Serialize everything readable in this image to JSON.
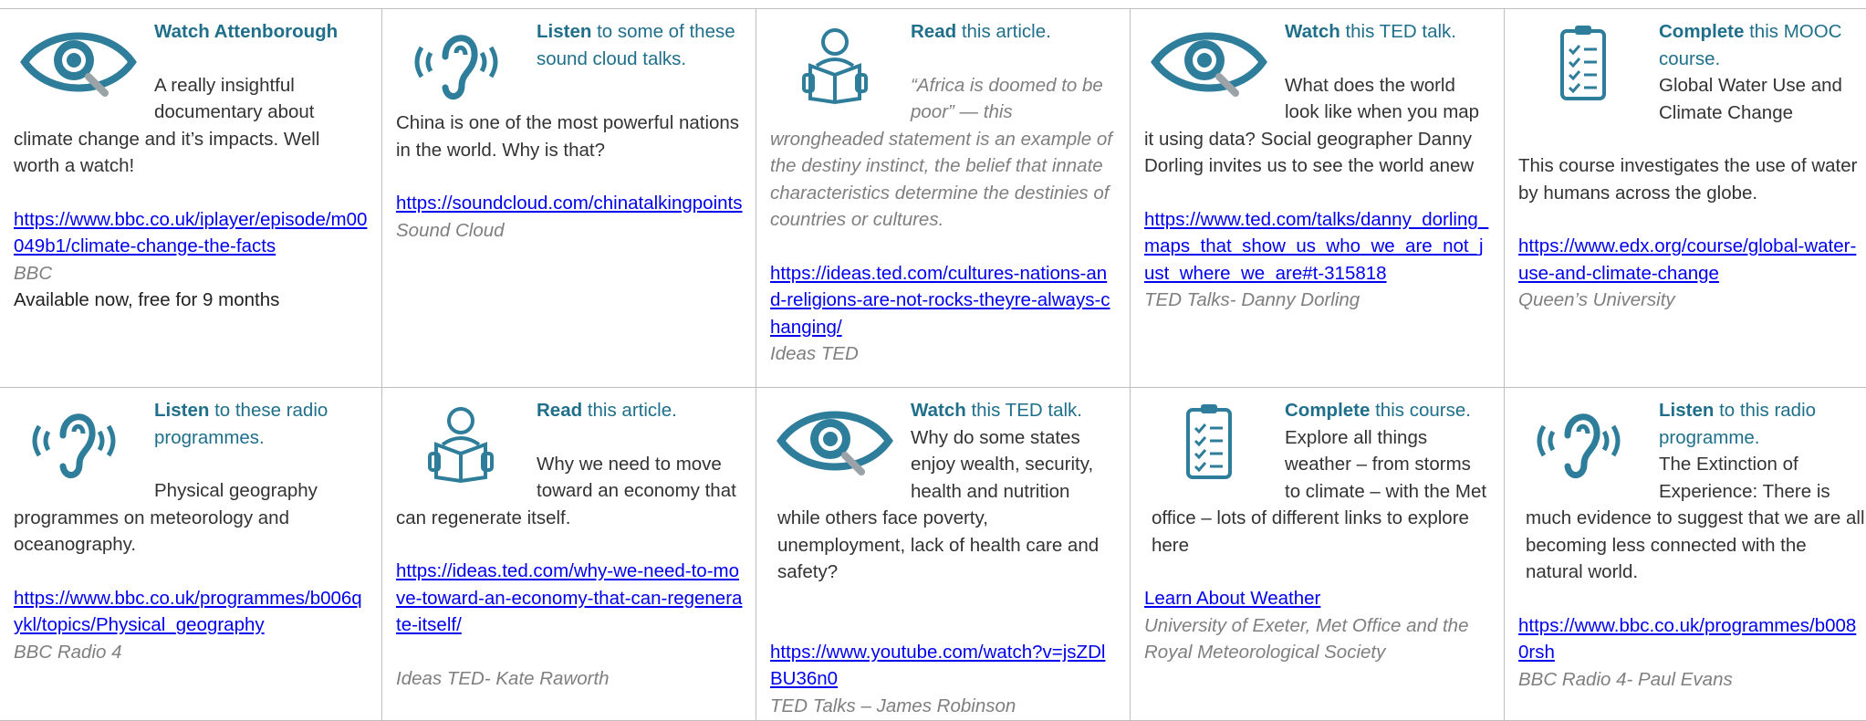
{
  "colors": {
    "heading": "#1f6f8b",
    "icon": "#2e7d9a",
    "link": "#0000ee",
    "source": "#7f7f7f",
    "border": "#bfbfbf"
  },
  "cells": [
    {
      "icon": "eye-icon",
      "verb": "Watch Attenborough",
      "rest": "",
      "desc": "A really insightful documentary about climate change and it’s impacts.  Well worth a watch!",
      "link": "https://www.bbc.co.uk/iplayer/episode/m00049b1/climate-change-the-facts",
      "source": "BBC",
      "extra": "Available now, free for 9 months"
    },
    {
      "icon": "ear-icon",
      "verb": "Listen",
      "rest": " to some of these sound cloud talks.",
      "desc": "China is one of the most powerful nations in the world. Why is that?",
      "link": "https://soundcloud.com/chinatalkingpoints",
      "source": "Sound Cloud"
    },
    {
      "icon": "reader-icon",
      "verb": "Read",
      "rest": " this article.",
      "desc": "“Africa is doomed to be poor” — this wrongheaded statement is an example of the destiny instinct, the belief that innate characteristics determine the destinies of countries or cultures.",
      "link": "https://ideas.ted.com/cultures-nations-and-religions-are-not-rocks-theyre-always-changing/",
      "source": "Ideas TED"
    },
    {
      "icon": "eye-icon",
      "verb": "Watch",
      "rest": " this TED talk.",
      "desc": "What does the world look like when you map it using data? Social geographer Danny Dorling invites us to see the world anew",
      "link": "https://www.ted.com/talks/danny_dorling_maps_that_show_us_who_we_are_not_just_where_we_are#t-315818",
      "source": "TED Talks- Danny Dorling"
    },
    {
      "icon": "clipboard-icon",
      "verb": "Complete",
      "rest": " this MOOC course.",
      "desc": "Global Water Use and Climate Change",
      "desc2": "This course investigates the use of water by humans across the globe.",
      "link": "https://www.edx.org/course/global-water-use-and-climate-change",
      "source": "Queen’s University"
    },
    {
      "icon": "ear-icon",
      "verb": "Listen",
      "rest": " to these radio programmes.",
      "desc": "Physical geography programmes on meteorology and oceanography.",
      "link": "https://www.bbc.co.uk/programmes/b006qykl/topics/Physical_geography",
      "source": "BBC Radio 4"
    },
    {
      "icon": "reader-icon",
      "verb": "Read",
      "rest": " this article.",
      "desc": "Why we need to move toward an economy that can regenerate itself.",
      "link": "https://ideas.ted.com/why-we-need-to-move-toward-an-economy-that-can-regenerate-itself/",
      "source": "Ideas TED- Kate Raworth"
    },
    {
      "icon": "eye-icon",
      "verb": "Watch",
      "rest": " this TED talk.",
      "desc": "Why do some states enjoy wealth, security, health and nutrition while others face poverty, unemployment, lack of health care and safety?",
      "link": "https://www.youtube.com/watch?v=jsZDlBU36n0",
      "source": "TED Talks – James Robinson"
    },
    {
      "icon": "clipboard-icon",
      "verb": "Complete",
      "rest": " this course.",
      "desc": "Explore all things weather – from storms to climate – with the Met office – lots of different links to explore here",
      "link": "Learn About Weather",
      "source": "University of Exeter, Met Office and the Royal Meteorological Society"
    },
    {
      "icon": "ear-icon",
      "verb": "Listen",
      "rest": " to this radio programme.",
      "desc": "The Extinction of Experience: There is much evidence to suggest that we are all becoming less connected with the natural world.",
      "link": "https://www.bbc.co.uk/programmes/b0080rsh",
      "source": "BBC Radio 4- Paul Evans"
    }
  ]
}
